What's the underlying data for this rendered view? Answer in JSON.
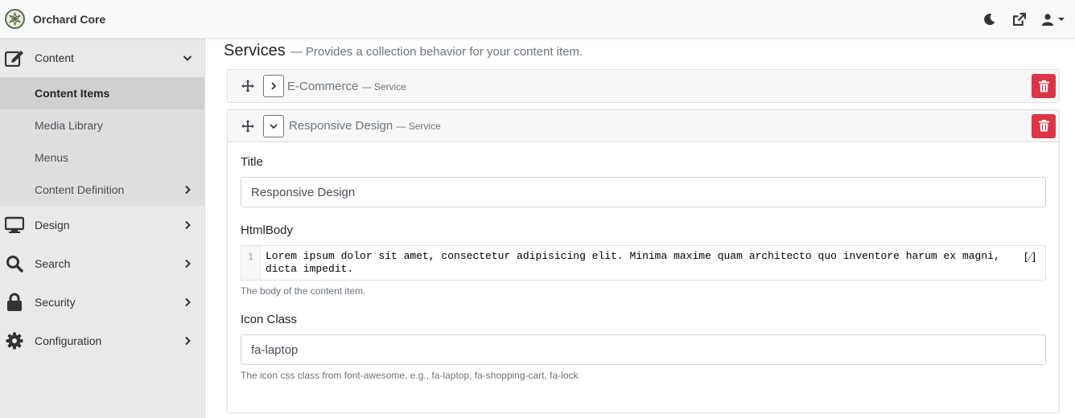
{
  "app": {
    "title": "Orchard Core"
  },
  "topbar": {
    "icons": [
      "moon-icon",
      "external-link-icon",
      "user-icon",
      "caret-down-icon"
    ]
  },
  "sidebar": {
    "items": [
      {
        "label": "Content",
        "icon": "edit-icon",
        "expanded": true,
        "children": [
          {
            "label": "Content Items",
            "active": true
          },
          {
            "label": "Media Library"
          },
          {
            "label": "Menus"
          },
          {
            "label": "Content Definition",
            "has_children": true
          }
        ]
      },
      {
        "label": "Design",
        "icon": "monitor-icon"
      },
      {
        "label": "Search",
        "icon": "search-icon"
      },
      {
        "label": "Security",
        "icon": "lock-icon"
      },
      {
        "label": "Configuration",
        "icon": "gear-icon"
      }
    ]
  },
  "main": {
    "title": "Services",
    "subtitle": "— Provides a collection behavior for your content item.",
    "cards": [
      {
        "title": "E-Commerce",
        "type": "— Service",
        "expanded": false
      },
      {
        "title": "Responsive Design",
        "type": "— Service",
        "expanded": true,
        "fields": {
          "title_label": "Title",
          "title_value": "Responsive Design",
          "htmlbody_label": "HtmlBody",
          "htmlbody_line_number": "1",
          "htmlbody_value": "Lorem ipsum dolor sit amet, consectetur adipisicing elit. Minima maxime quam architecto quo inventore harum ex magni, dicta impedit.",
          "htmlbody_hint": "The body of the content item.",
          "htmlbody_expand": "[⁄]",
          "icon_label": "Icon Class",
          "icon_value": "fa-laptop",
          "icon_hint": "The icon css class from font-awesome. e.g., fa-laptop, fa-shopping-cart, fa-lock"
        }
      }
    ]
  },
  "colors": {
    "danger": "#dc3545",
    "sidebar_bg": "#e9e9e9",
    "active_bg": "#d0d0d0"
  }
}
